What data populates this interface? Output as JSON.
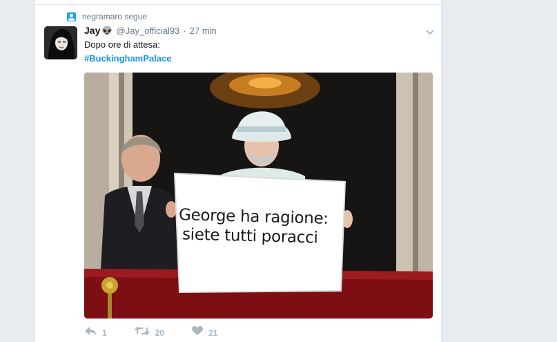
{
  "context": {
    "text": "negramaro segue",
    "icon": "person-icon"
  },
  "tweet": {
    "fullname": "Jay",
    "emoji": "👽",
    "username": "@Jay_official93",
    "separator": "·",
    "time": "27 min",
    "text": "Dopo ore di attesa:",
    "hashtag": "#BuckinghamPalace",
    "media": {
      "sign_line1": "George ha ragione:",
      "sign_line2": "siete tutti poracci"
    },
    "actions": {
      "reply_count": "1",
      "retweet_count": "20",
      "like_count": "21"
    }
  },
  "colors": {
    "accent": "#1b95e0",
    "muted": "#657786",
    "action_icon": "#aab8c2",
    "background": "#e6ecf0"
  }
}
